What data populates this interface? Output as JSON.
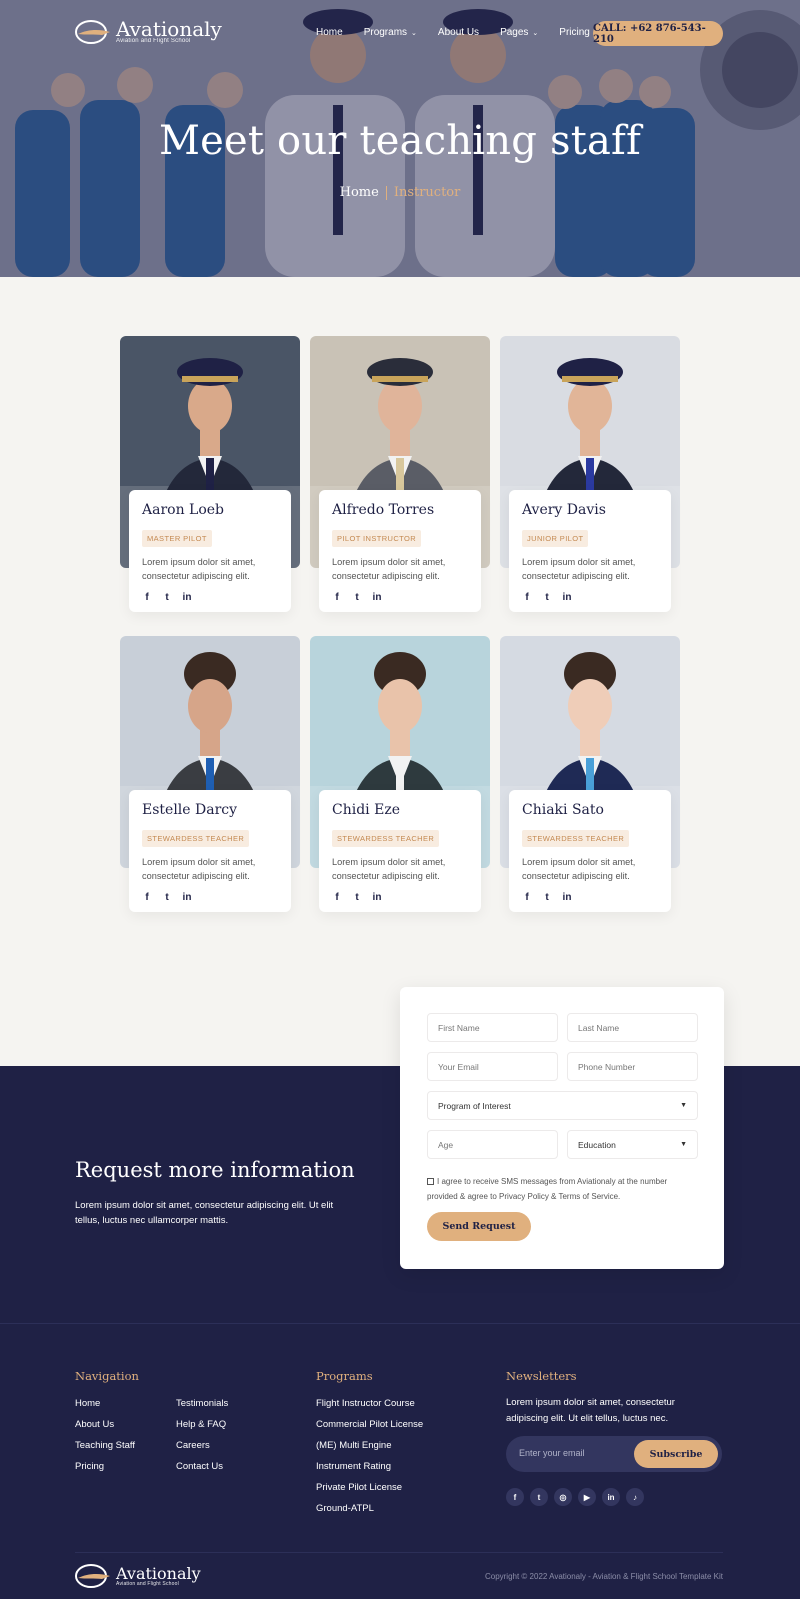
{
  "brand": {
    "name": "Avationaly",
    "tagline": "Aviation and Flight School"
  },
  "nav": {
    "items": [
      {
        "label": "Home",
        "has_dropdown": false
      },
      {
        "label": "Programs",
        "has_dropdown": true
      },
      {
        "label": "About Us",
        "has_dropdown": false
      },
      {
        "label": "Pages",
        "has_dropdown": true
      },
      {
        "label": "Pricing",
        "has_dropdown": false
      }
    ],
    "call_label": "CALL: +62 876-543-210"
  },
  "hero": {
    "title": "Meet our teaching staff",
    "breadcrumb": [
      "Home",
      "Instructor"
    ]
  },
  "staff": [
    {
      "name": "Aaron Loeb",
      "role": "MASTER PILOT",
      "bio": "Lorem ipsum dolor sit amet, consectetur adipiscing elit."
    },
    {
      "name": "Alfredo Torres",
      "role": "PILOT INSTRUCTOR",
      "bio": "Lorem ipsum dolor sit amet, consectetur adipiscing elit."
    },
    {
      "name": "Avery Davis",
      "role": "JUNIOR PILOT",
      "bio": "Lorem ipsum dolor sit amet, consectetur adipiscing elit."
    },
    {
      "name": "Estelle Darcy",
      "role": "STEWARDESS TEACHER",
      "bio": "Lorem ipsum dolor sit amet, consectetur adipiscing elit."
    },
    {
      "name": "Chidi Eze",
      "role": "STEWARDESS TEACHER",
      "bio": "Lorem ipsum dolor sit amet, consectetur adipiscing elit."
    },
    {
      "name": "Chiaki Sato",
      "role": "STEWARDESS TEACHER",
      "bio": "Lorem ipsum dolor sit amet, consectetur adipiscing elit."
    }
  ],
  "social_icons": [
    "facebook-icon",
    "twitter-icon",
    "linkedin-icon"
  ],
  "request": {
    "title": "Request more information",
    "text": "Lorem ipsum dolor sit amet, consectetur adipiscing elit. Ut elit tellus, luctus nec ullamcorper mattis."
  },
  "form": {
    "first_name": "First Name",
    "last_name": "Last Name",
    "email": "Your Email",
    "phone": "Phone Number",
    "program": "Program of Interest",
    "age": "Age",
    "education": "Education",
    "agree": "I agree to receive SMS messages from Aviationaly at the number provided & agree to Privacy Policy & Terms of Service.",
    "submit": "Send Request"
  },
  "footer": {
    "navigation_title": "Navigation",
    "navigation_col1": [
      "Home",
      "About Us",
      "Teaching Staff",
      "Pricing"
    ],
    "navigation_col2": [
      "Testimonials",
      "Help & FAQ",
      "Careers",
      "Contact Us"
    ],
    "programs_title": "Programs",
    "programs": [
      "Flight Instructor Course",
      "Commercial Pilot License",
      "(ME) Multi Engine",
      "Instrument Rating",
      "Private Pilot License",
      "Ground-ATPL"
    ],
    "newsletter_title": "Newsletters",
    "newsletter_text": "Lorem ipsum dolor sit amet, consectetur adipiscing elit. Ut elit tellus, luctus nec.",
    "email_placeholder": "Enter your email",
    "subscribe": "Subscribe",
    "social": [
      "facebook-icon",
      "twitter-icon",
      "instagram-icon",
      "youtube-icon",
      "linkedin-icon",
      "tiktok-icon"
    ],
    "copyright": "Copyright © 2022 Avationaly - Aviation & Flight School Template Kit"
  },
  "colors": {
    "navy": "#1f2145",
    "gold": "#e0b07e",
    "page_bg": "#f5f4f1"
  }
}
